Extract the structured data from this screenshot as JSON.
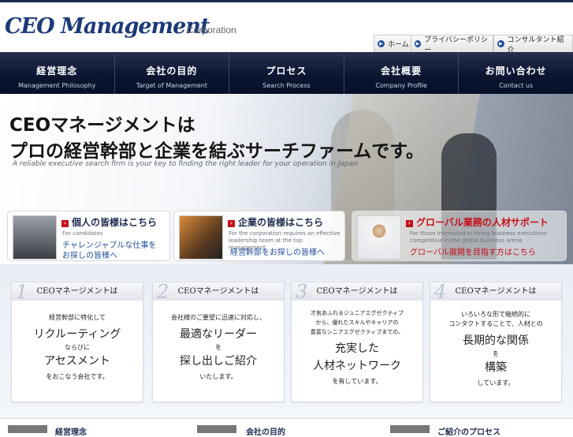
{
  "brand": {
    "logo": "CEO Management",
    "suffix": "Corporation"
  },
  "util_nav": [
    {
      "label": "ホーム"
    },
    {
      "label": "プライバシーポリシー"
    },
    {
      "label": "コンサルタント紹介"
    }
  ],
  "main_nav": [
    {
      "jp": "経営理念",
      "en": "Management Philosophy"
    },
    {
      "jp": "会社の目的",
      "en": "Target of Management"
    },
    {
      "jp": "プロセス",
      "en": "Search Process"
    },
    {
      "jp": "会社概要",
      "en": "Company Profile"
    },
    {
      "jp": "お問い合わせ",
      "en": "Contact us"
    }
  ],
  "hero": {
    "line1": "CEOマネージメントは",
    "line2": "プロの経営幹部と企業を結ぶサーチファームです。",
    "tagline": "A reliable executive search firm is your key to finding the right leader for your operation in Japan"
  },
  "cards": [
    {
      "title": "個人の皆様はこちら",
      "sub": "For candidates",
      "link1": "チャレンジャブルな仕事を",
      "link2": "お探しの皆様へ"
    },
    {
      "title": "企業の皆様はこちら",
      "sub": "For the corporation requires an effective leadership team at the top management",
      "link1": "経営幹部をお探しの皆様へ",
      "link2": ""
    },
    {
      "title": "グローバル業務の人材サポート",
      "sub": "For those interested in hiring business executives competitive in the global business arena",
      "link1": "グローバル展開を目指す方はこちら",
      "link2": ""
    }
  ],
  "features": [
    {
      "num": "1",
      "header": "CEOマネージメントは",
      "t1": "経営幹部に特化して",
      "big1": "リクルーティング",
      "mid": "ならびに",
      "big2": "アセスメント",
      "t2": "をおこなう会社です。"
    },
    {
      "num": "2",
      "header": "CEOマネージメントは",
      "t1": "会社様のご要望に迅速に対応し、",
      "big1": "最適なリーダー",
      "mid": "を",
      "big2": "探し出しご紹介",
      "t2": "いたします。"
    },
    {
      "num": "3",
      "header": "CEOマネージメントは",
      "t1a": "才気あふれるジュニアエグゼクティブ",
      "t1b": "から、優れたスキルやキャリアの",
      "t1c": "豊富なシニアエグゼクティブまでの、",
      "big1": "充実した",
      "big2": "人材ネットワーク",
      "t2": "を有しています。"
    },
    {
      "num": "4",
      "header": "CEOマネージメントは",
      "t1a": "いろいろな形で継続的に",
      "t1b": "コンタクトすることで、人材との",
      "big1": "長期的な関係",
      "mid": "を",
      "big2": "構築",
      "t2": "しています。"
    }
  ],
  "bottom_links": [
    {
      "label": "経営理念"
    },
    {
      "label": "会社の目的"
    },
    {
      "label": "ご紹介のプロセス"
    }
  ]
}
